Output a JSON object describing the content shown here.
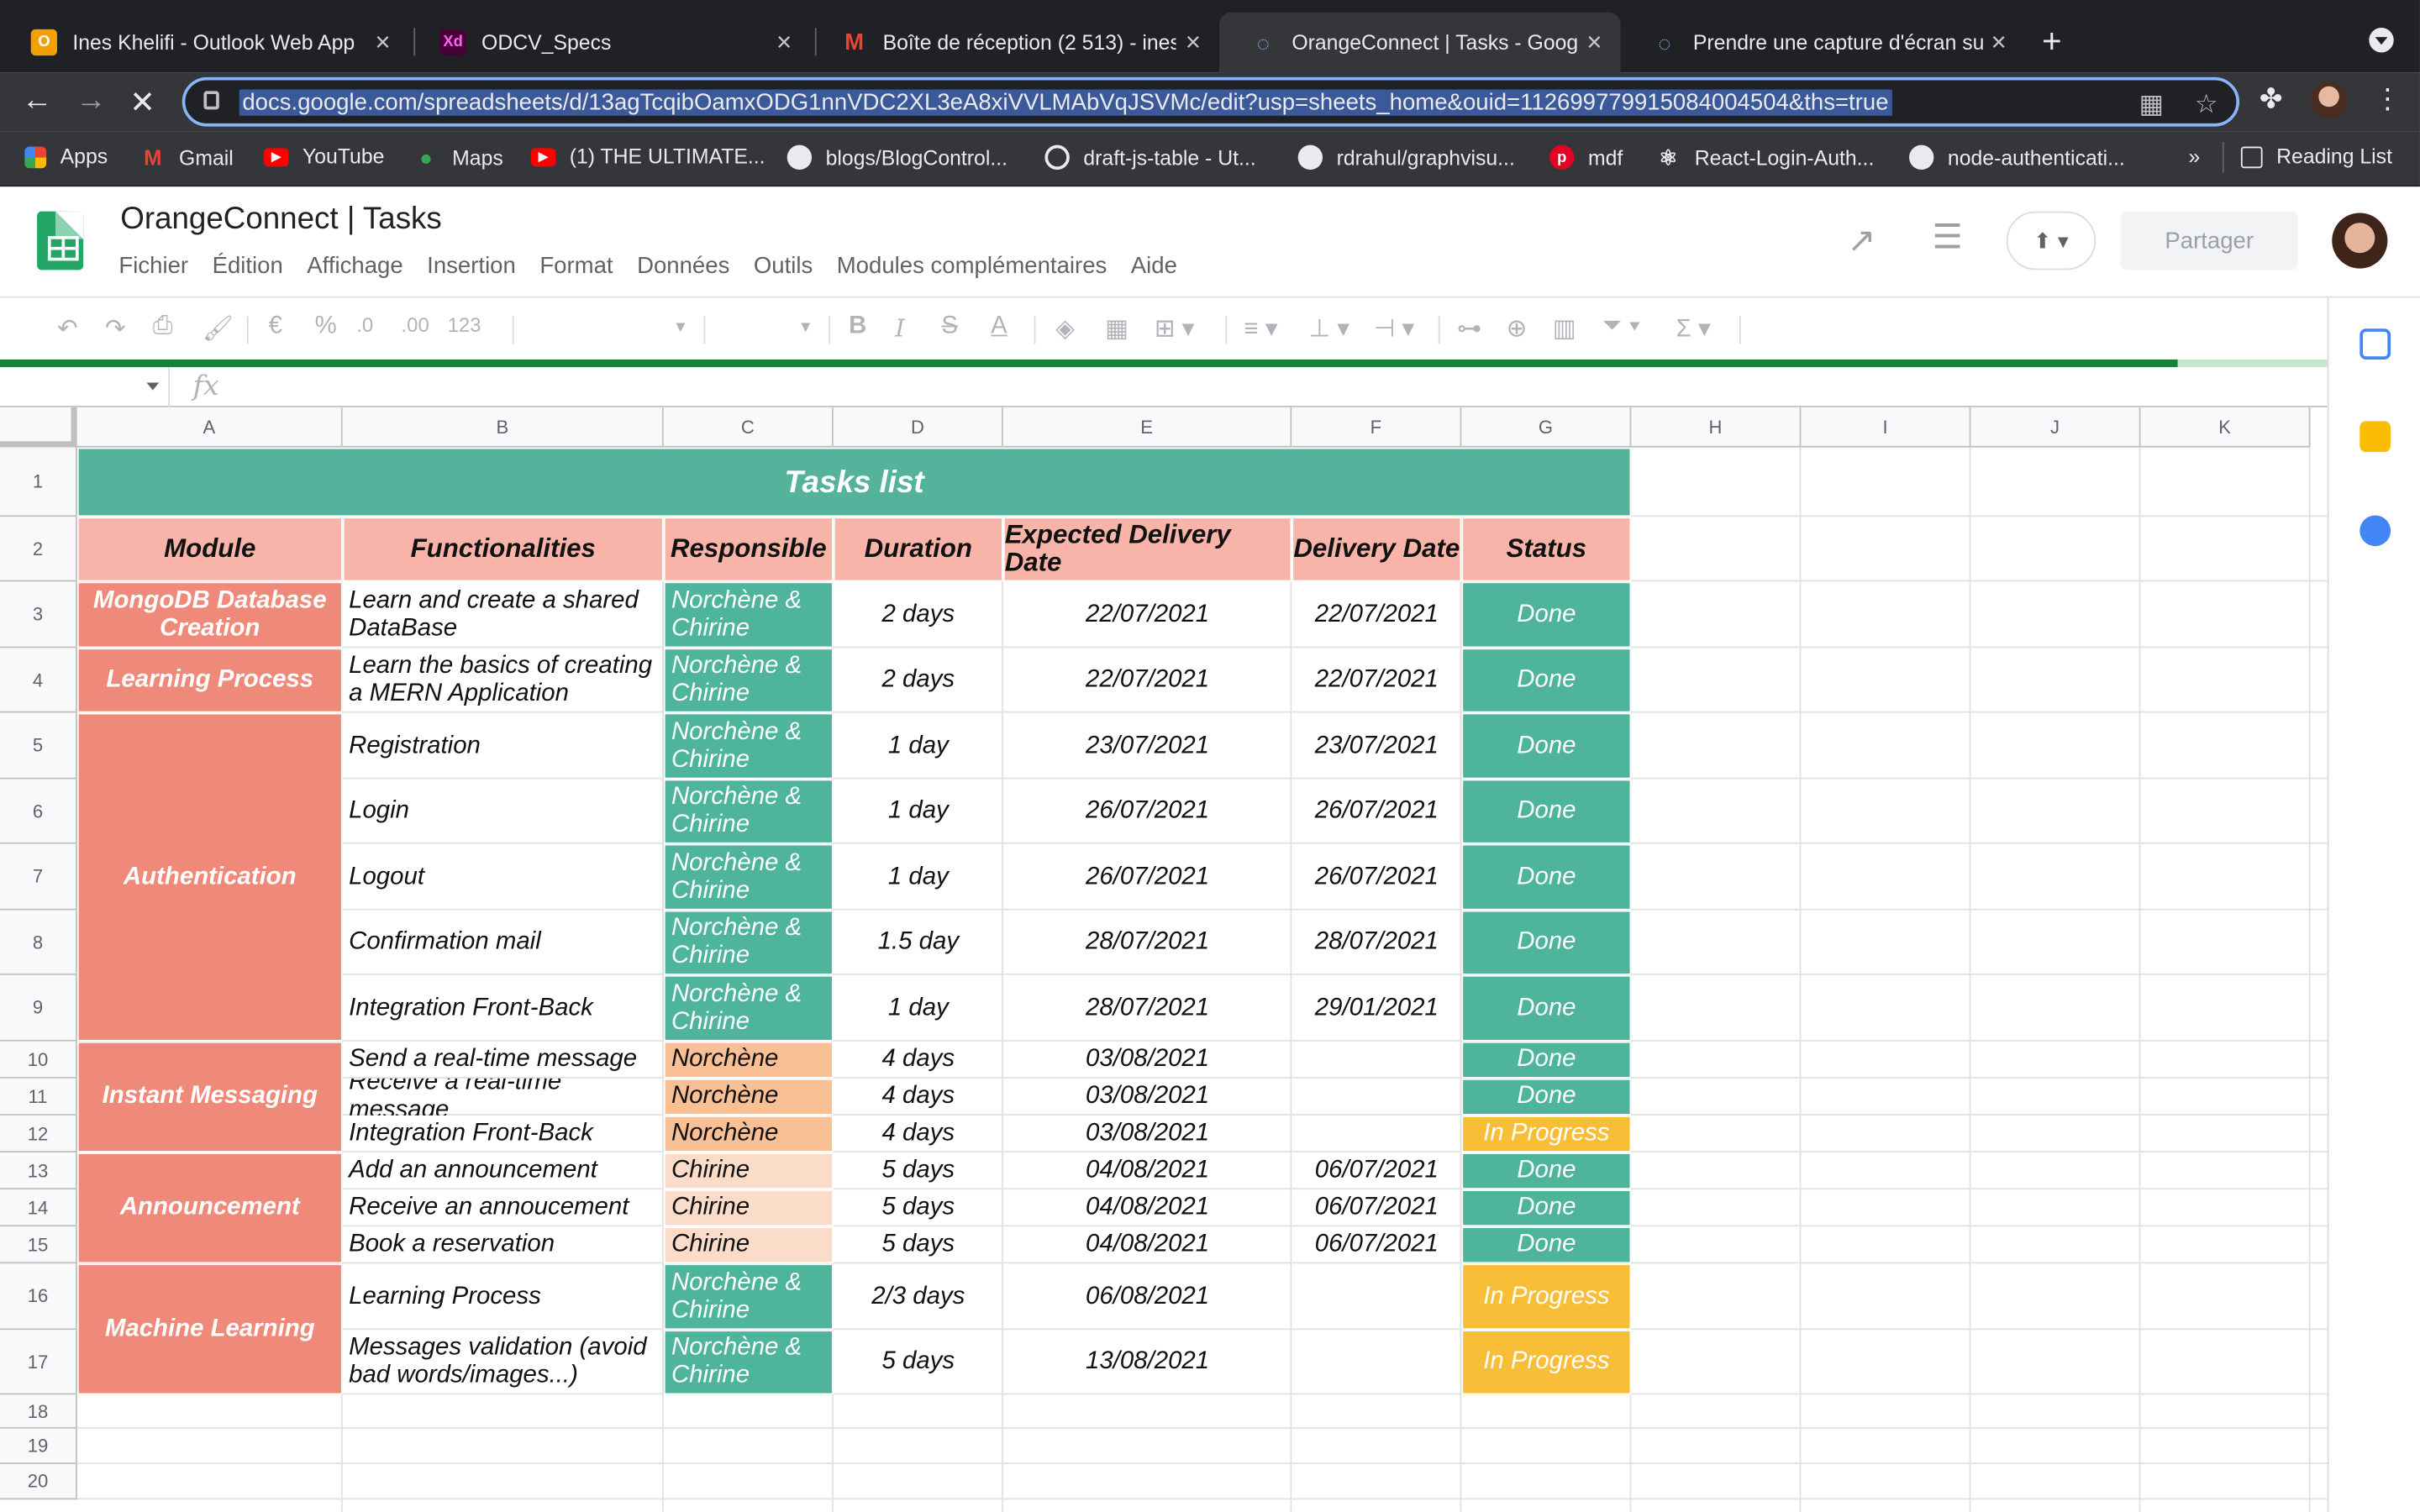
{
  "browser": {
    "tabs": [
      {
        "title": "Ines Khelifi - Outlook Web App",
        "icon": "outlook-icon",
        "icon_bg": "#f2a100",
        "icon_glyph": "O"
      },
      {
        "title": "ODCV_Specs",
        "icon": "adobe-xd-icon",
        "icon_bg": "#470137",
        "icon_glyph": "Xd"
      },
      {
        "title": "Boîte de réception (2 513) - ines",
        "icon": "gmail-icon",
        "icon_bg": "#ffffff",
        "icon_glyph": "M"
      },
      {
        "title": "OrangeConnect | Tasks - Goog",
        "icon": "loading-icon",
        "icon_bg": "#35363a",
        "icon_glyph": "◌"
      },
      {
        "title": "Prendre une capture d'écran su",
        "icon": "loading-icon",
        "icon_bg": "#202124",
        "icon_glyph": "◌"
      }
    ],
    "url": "docs.google.com/spreadsheets/d/13agTcqibOamxODG1nnVDC2XL3eA8xiVVLMAbVqJSVMc/edit?usp=sheets_home&ouid=112699779915084004504&ths=true",
    "bookmarks": [
      {
        "label": "Apps",
        "icon": "apps-grid-icon",
        "color": "#ea4335"
      },
      {
        "label": "Gmail",
        "icon": "gmail-icon",
        "color": "#ea4335"
      },
      {
        "label": "YouTube",
        "icon": "youtube-icon",
        "color": "#ff0000"
      },
      {
        "label": "Maps",
        "icon": "maps-pin-icon",
        "color": "#34a853"
      },
      {
        "label": "(1) THE ULTIMATE...",
        "icon": "youtube-icon",
        "color": "#ff0000"
      },
      {
        "label": "blogs/BlogControl...",
        "icon": "github-icon",
        "color": "#e8eaed"
      },
      {
        "label": "draft-js-table - Ut...",
        "icon": "globe-icon",
        "color": "#e8eaed"
      },
      {
        "label": "rdrahul/graphvisu...",
        "icon": "github-icon",
        "color": "#e8eaed"
      },
      {
        "label": "mdf",
        "icon": "pinterest-icon",
        "color": "#e60023"
      },
      {
        "label": "React-Login-Auth...",
        "icon": "react-icon",
        "color": "#e8eaed"
      },
      {
        "label": "node-authenticati...",
        "icon": "github-icon",
        "color": "#e8eaed"
      }
    ],
    "overflow_label": "»",
    "reading_list": "Reading List"
  },
  "sheets": {
    "doc_title": "OrangeConnect | Tasks",
    "menu": [
      "Fichier",
      "Édition",
      "Affichage",
      "Insertion",
      "Format",
      "Données",
      "Outils",
      "Modules complémentaires",
      "Aide"
    ],
    "share_label": "Partager",
    "fx_label": "fx",
    "zoom_format": "123"
  },
  "grid": {
    "columns": [
      "A",
      "B",
      "C",
      "D",
      "E",
      "F",
      "G",
      "H",
      "I",
      "J",
      "K"
    ],
    "rows": [
      "1",
      "2",
      "3",
      "4",
      "5",
      "6",
      "7",
      "8",
      "9",
      "10",
      "11",
      "12",
      "13",
      "14",
      "15",
      "16",
      "17",
      "18",
      "19",
      "20"
    ]
  },
  "table": {
    "title": "Tasks list",
    "headers": [
      "Module",
      "Functionalities",
      "Responsible",
      "Duration",
      "Expected Delivery Date",
      "Delivery Date",
      "Status"
    ],
    "modules": [
      "MongoDB Database Creation",
      "Learning Process",
      "Authentication",
      "Instant Messaging",
      "Announcement",
      "Machine Learning"
    ],
    "rows": [
      {
        "func": "Learn and create a shared DataBase",
        "resp": "Norchène & Chirine",
        "dur": "2 days",
        "exp": "22/07/2021",
        "del": "22/07/2021",
        "status": "Done"
      },
      {
        "func": "Learn the basics of creating a MERN Application",
        "resp": "Norchène & Chirine",
        "dur": "2 days",
        "exp": "22/07/2021",
        "del": "22/07/2021",
        "status": "Done"
      },
      {
        "func": "Registration",
        "resp": "Norchène & Chirine",
        "dur": "1 day",
        "exp": "23/07/2021",
        "del": "23/07/2021",
        "status": "Done"
      },
      {
        "func": "Login",
        "resp": "Norchène & Chirine",
        "dur": "1 day",
        "exp": "26/07/2021",
        "del": "26/07/2021",
        "status": "Done"
      },
      {
        "func": "Logout",
        "resp": "Norchène & Chirine",
        "dur": "1 day",
        "exp": "26/07/2021",
        "del": "26/07/2021",
        "status": "Done"
      },
      {
        "func": "Confirmation mail",
        "resp": "Norchène & Chirine",
        "dur": "1.5 day",
        "exp": "28/07/2021",
        "del": "28/07/2021",
        "status": "Done"
      },
      {
        "func": "Integration Front-Back",
        "resp": "Norchène & Chirine",
        "dur": "1 day",
        "exp": "28/07/2021",
        "del": "29/01/2021",
        "status": "Done"
      },
      {
        "func": "Send a real-time message",
        "resp": "Norchène",
        "dur": "4 days",
        "exp": "03/08/2021",
        "del": "",
        "status": "Done"
      },
      {
        "func": "Receive a real-time message",
        "resp": "Norchène",
        "dur": "4 days",
        "exp": "03/08/2021",
        "del": "",
        "status": "Done"
      },
      {
        "func": "Integration Front-Back",
        "resp": "Norchène",
        "dur": "4 days",
        "exp": "03/08/2021",
        "del": "",
        "status": "In Progress"
      },
      {
        "func": "Add an announcement",
        "resp": "Chirine",
        "dur": "5 days",
        "exp": "04/08/2021",
        "del": "06/07/2021",
        "status": "Done"
      },
      {
        "func": "Receive an annoucement",
        "resp": "Chirine",
        "dur": "5 days",
        "exp": "04/08/2021",
        "del": "06/07/2021",
        "status": "Done"
      },
      {
        "func": "Book a reservation",
        "resp": "Chirine",
        "dur": "5 days",
        "exp": "04/08/2021",
        "del": "06/07/2021",
        "status": "Done"
      },
      {
        "func": "Learning Process",
        "resp": "Norchène & Chirine",
        "dur": "2/3 days",
        "exp": "06/08/2021",
        "del": "",
        "status": "In Progress"
      },
      {
        "func": "Messages validation (avoid bad words/images...)",
        "resp": "Norchène & Chirine",
        "dur": "5 days",
        "exp": "13/08/2021",
        "del": "",
        "status": "In Progress"
      }
    ]
  },
  "colors": {
    "title_bg": "#55b39c",
    "header_bg": "#f8b4a8",
    "module_bg": "#ef8a7a",
    "done": "#4fb49c",
    "in_progress": "#f9be38"
  }
}
